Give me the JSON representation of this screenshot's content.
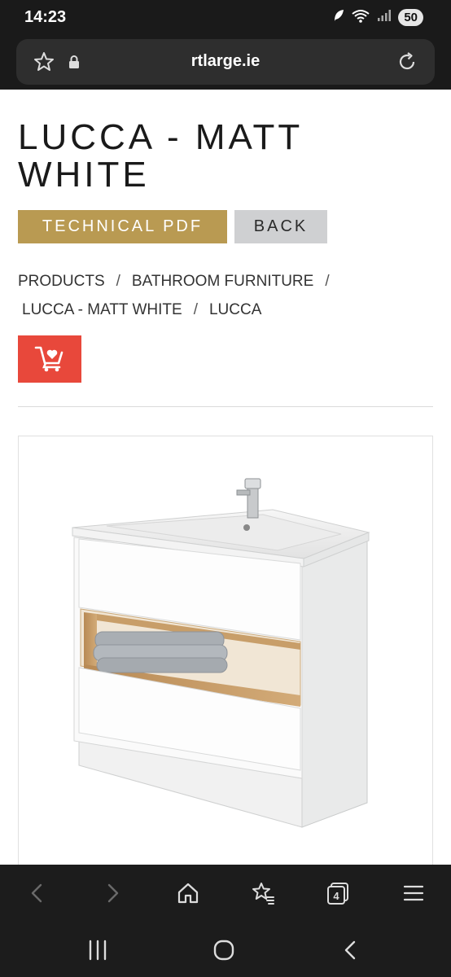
{
  "status": {
    "time": "14:23",
    "battery": "50"
  },
  "browser": {
    "url": "rtlarge.ie",
    "tab_count": "4"
  },
  "product": {
    "title": "LUCCA - MATT WHITE"
  },
  "buttons": {
    "technical_pdf": "TECHNICAL PDF",
    "back": "BACK"
  },
  "breadcrumb": {
    "items": [
      "PRODUCTS",
      "BATHROOM FURNITURE",
      "LUCCA - MATT WHITE",
      "LUCCA"
    ],
    "separator": "/"
  },
  "colors": {
    "accent_gold": "#b99a52",
    "wishlist_red": "#e8483b",
    "back_grey": "#cfd0d2"
  },
  "icons": {
    "status": [
      "leaf-icon",
      "wifi-icon",
      "signal-icon"
    ],
    "address_bar": [
      "star-icon",
      "lock-icon",
      "reload-icon"
    ],
    "wishlist": "cart-heart-icon",
    "browser_bottom": [
      "back-arrow-icon",
      "forward-arrow-icon",
      "home-icon",
      "bookmarks-icon",
      "tabs-icon",
      "menu-icon"
    ],
    "android_nav": [
      "recents-icon",
      "home-circle-icon",
      "back-icon"
    ]
  }
}
